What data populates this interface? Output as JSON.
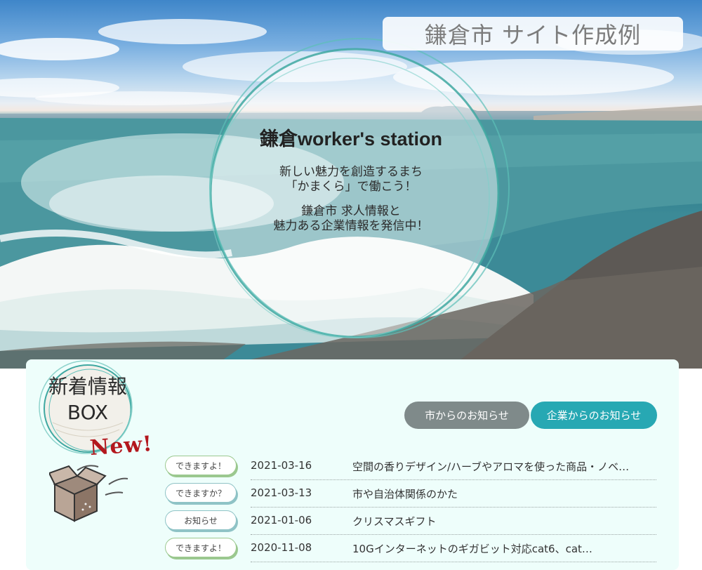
{
  "header": {
    "site_title": "鎌倉市 サイト作成例"
  },
  "hero": {
    "title": "鎌倉worker's station",
    "line1": "新しい魅力を創造するまち",
    "line2": "「かまくら」で働こう！",
    "line3": "鎌倉市 求人情報と",
    "line4": "魅力ある企業情報を発信中！"
  },
  "news": {
    "badge_line1": "新着情報",
    "badge_line2": "BOX",
    "new_label": "New!",
    "tabs": [
      {
        "label": "市からのお知らせ"
      },
      {
        "label": "企業からのお知らせ"
      }
    ],
    "items": [
      {
        "tag": "できますよ！",
        "date": "2021-03-16",
        "title": "空間の香りデザイン/ハーブやアロマを使った商品・ノベ…"
      },
      {
        "tag": "できますか？",
        "date": "2021-03-13",
        "title": "市や自治体関係のかた"
      },
      {
        "tag": "お知らせ",
        "date": "2021-01-06",
        "title": "クリスマスギフト"
      },
      {
        "tag": "できますよ！",
        "date": "2020-11-08",
        "title": "10Gインターネットのギガビット対応cat6、cat…"
      }
    ]
  },
  "colors": {
    "tab_city": "#7f8a8a",
    "tab_company": "#27a8b3",
    "panel_bg": "#eefefb",
    "new_label": "#b3171d"
  }
}
